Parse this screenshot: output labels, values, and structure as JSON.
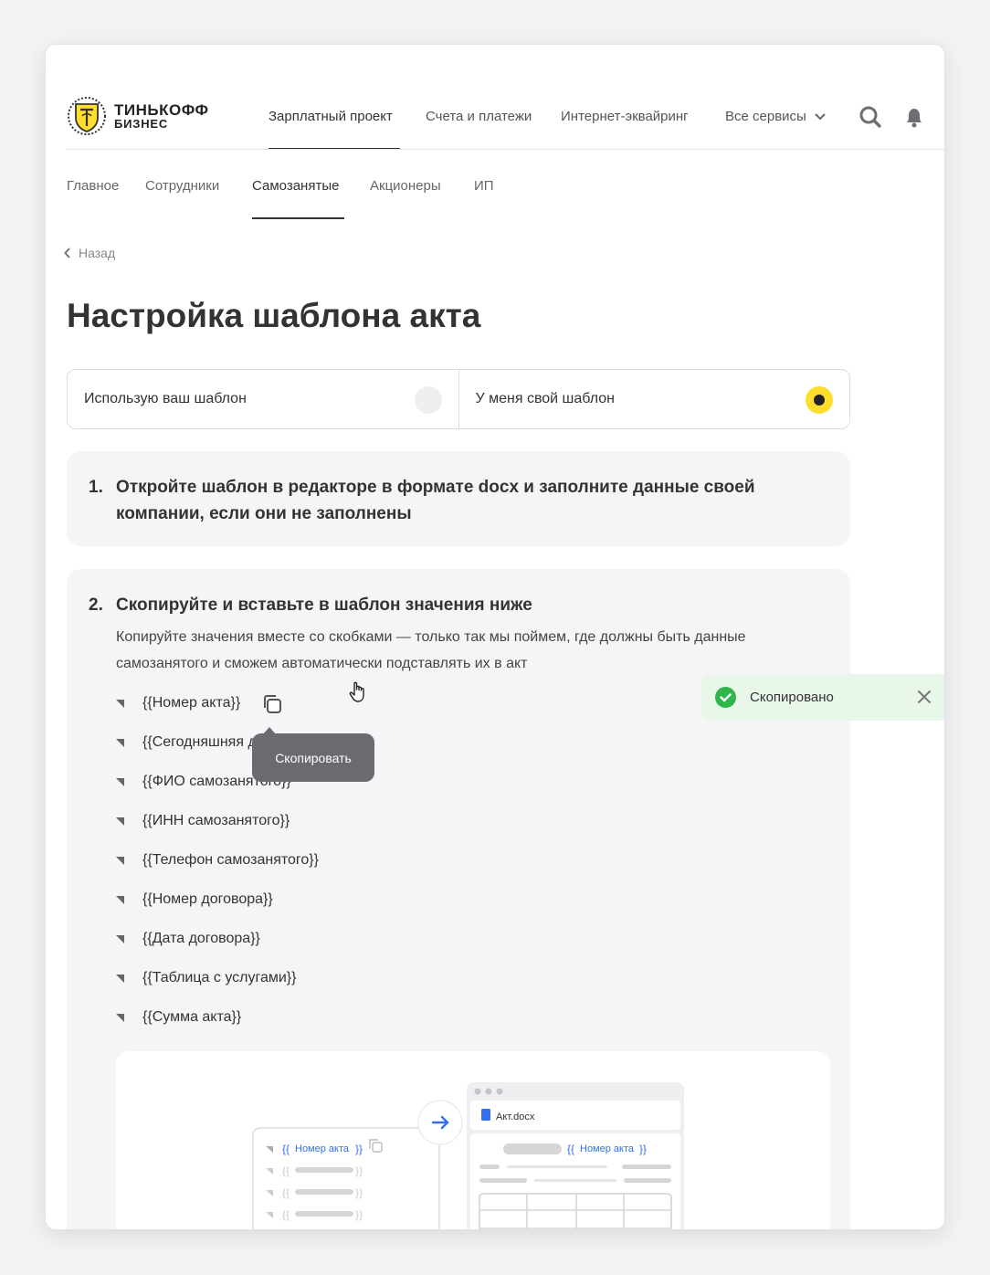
{
  "brand": {
    "name_line1": "ТИНЬКОФФ",
    "name_line2": "БИЗНЕС",
    "accent": "#ffdd2d"
  },
  "topnav": {
    "items": [
      {
        "label": "Зарплатный проект",
        "active": true
      },
      {
        "label": "Счета и платежи",
        "active": false
      },
      {
        "label": "Интернет-эквайринг",
        "active": false
      },
      {
        "label": "Все сервисы",
        "active": false,
        "icon": "chevron-down-icon"
      }
    ],
    "icons": [
      "search-icon",
      "bell-icon"
    ]
  },
  "subnav": {
    "items": [
      {
        "label": "Главное",
        "active": false
      },
      {
        "label": "Сотрудники",
        "active": false
      },
      {
        "label": "Самозанятые",
        "active": true
      },
      {
        "label": "Акционеры",
        "active": false
      },
      {
        "label": "ИП",
        "active": false
      }
    ]
  },
  "back": {
    "label": "Назад"
  },
  "page": {
    "title": "Настройка шаблона акта"
  },
  "template_switch": {
    "options": [
      {
        "label": "Использую ваш шаблон",
        "selected": false
      },
      {
        "label": "У меня свой шаблон",
        "selected": true
      }
    ]
  },
  "step1": {
    "number": "1.",
    "title": "Откройте шаблон в редакторе в формате docx и заполните данные своей компании, если они не заполнены"
  },
  "step2": {
    "number": "2.",
    "title": "Скопируйте и вставьте в шаблон значения ниже",
    "description": "Копируйте значения вместе со скобками — только так мы поймем, где должны быть данные самозанятого и сможем автоматически подставлять их в акт",
    "tokens": [
      "{{Номер акта}}",
      "{{Сегодняшняя дата}}",
      "{{ФИО самозанятого}}",
      "{{ИНН самозанятого}}",
      "{{Телефон самозанятого}}",
      "{{Номер договора}}",
      "{{Дата договора}}",
      "{{Таблица с услугами}}",
      "{{Сумма акта}}"
    ],
    "tooltip": "Скопировать"
  },
  "illustration": {
    "token_label": "Номер акта",
    "doc_name": "Акт.docx",
    "token_color": "#336fee"
  },
  "toast": {
    "label": "Скопировано",
    "color": "#2fb54a"
  }
}
